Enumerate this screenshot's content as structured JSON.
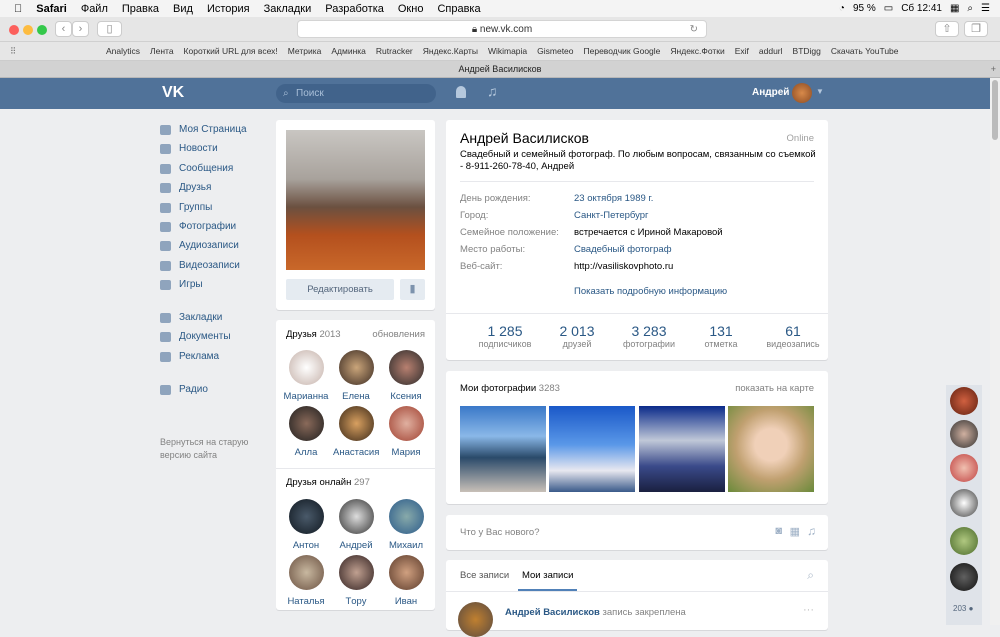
{
  "menubar": {
    "apple": "",
    "app": "Safari",
    "items": [
      "Файл",
      "Правка",
      "Вид",
      "История",
      "Закладки",
      "Разработка",
      "Окно",
      "Справка"
    ],
    "battery": "95 %",
    "clock": "Сб 12:41"
  },
  "browser": {
    "url": "new.vk.com",
    "bookmarks": [
      "Analytics",
      "Лента",
      "Короткий URL для всех!",
      "Метрика",
      "Админка",
      "Rutracker",
      "Яндекс.Карты",
      "Wikimapia",
      "Gismeteo",
      "Переводчик Google",
      "Яндекс.Фотки",
      "Exif",
      "addurl",
      "BTDigg",
      "Скачать YouTube"
    ],
    "tab_title": "Андрей Василисков"
  },
  "header": {
    "logo": "VK",
    "search_placeholder": "Поиск",
    "user": "Андрей"
  },
  "nav": {
    "items": [
      "Моя Страница",
      "Новости",
      "Сообщения",
      "Друзья",
      "Группы",
      "Фотографии",
      "Аудиозаписи",
      "Видеозаписи",
      "Игры"
    ],
    "items2": [
      "Закладки",
      "Документы",
      "Реклама"
    ],
    "items3": [
      "Радио"
    ],
    "old_version": "Вернуться на старую версию сайта"
  },
  "profile": {
    "edit": "Редактировать",
    "name": "Андрей Василисков",
    "online": "Online",
    "status": "Свадебный и семейный фотограф. По любым вопросам, связанным со съемкой - 8-911-260-78-40, Андрей",
    "info": [
      {
        "label": "День рождения:",
        "value": "23 октября 1989 г."
      },
      {
        "label": "Город:",
        "value": "Санкт-Петербург"
      },
      {
        "label": "Семейное положение:",
        "value": "встречается с Ириной Макаровой"
      },
      {
        "label": "Место работы:",
        "value": "Свадебный фотограф"
      },
      {
        "label": "Веб-сайт:",
        "value": "http://vasiliskovphoto.ru"
      }
    ],
    "more": "Показать подробную информацию",
    "counters": [
      {
        "n": "1 285",
        "t": "подписчиков"
      },
      {
        "n": "2 013",
        "t": "друзей"
      },
      {
        "n": "3 283",
        "t": "фотографии"
      },
      {
        "n": "131",
        "t": "отметка"
      },
      {
        "n": "61",
        "t": "видеозапись"
      }
    ]
  },
  "friends": {
    "title": "Друзья",
    "count": "2013",
    "updates": "обновления",
    "list": [
      "Марианна",
      "Елена",
      "Ксения",
      "Алла",
      "Анастасия",
      "Мария"
    ],
    "online_title": "Друзья онлайн",
    "online_count": "297",
    "online": [
      "Антон",
      "Андрей",
      "Михаил",
      "Наталья",
      "Тopy",
      "Иван"
    ]
  },
  "photos": {
    "title": "Мои фотографии",
    "count": "3283",
    "map": "показать на карте"
  },
  "post": {
    "placeholder": "Что у Вас нового?"
  },
  "wall": {
    "tabs": [
      "Все записи",
      "Мои записи"
    ],
    "author": "Андрей Василисков",
    "pinned": "запись закреплена",
    "more": "···"
  },
  "side": {
    "count": "203"
  },
  "colors": {
    "header": "#507299",
    "link": "#2a5885",
    "bg": "#edeef0"
  }
}
